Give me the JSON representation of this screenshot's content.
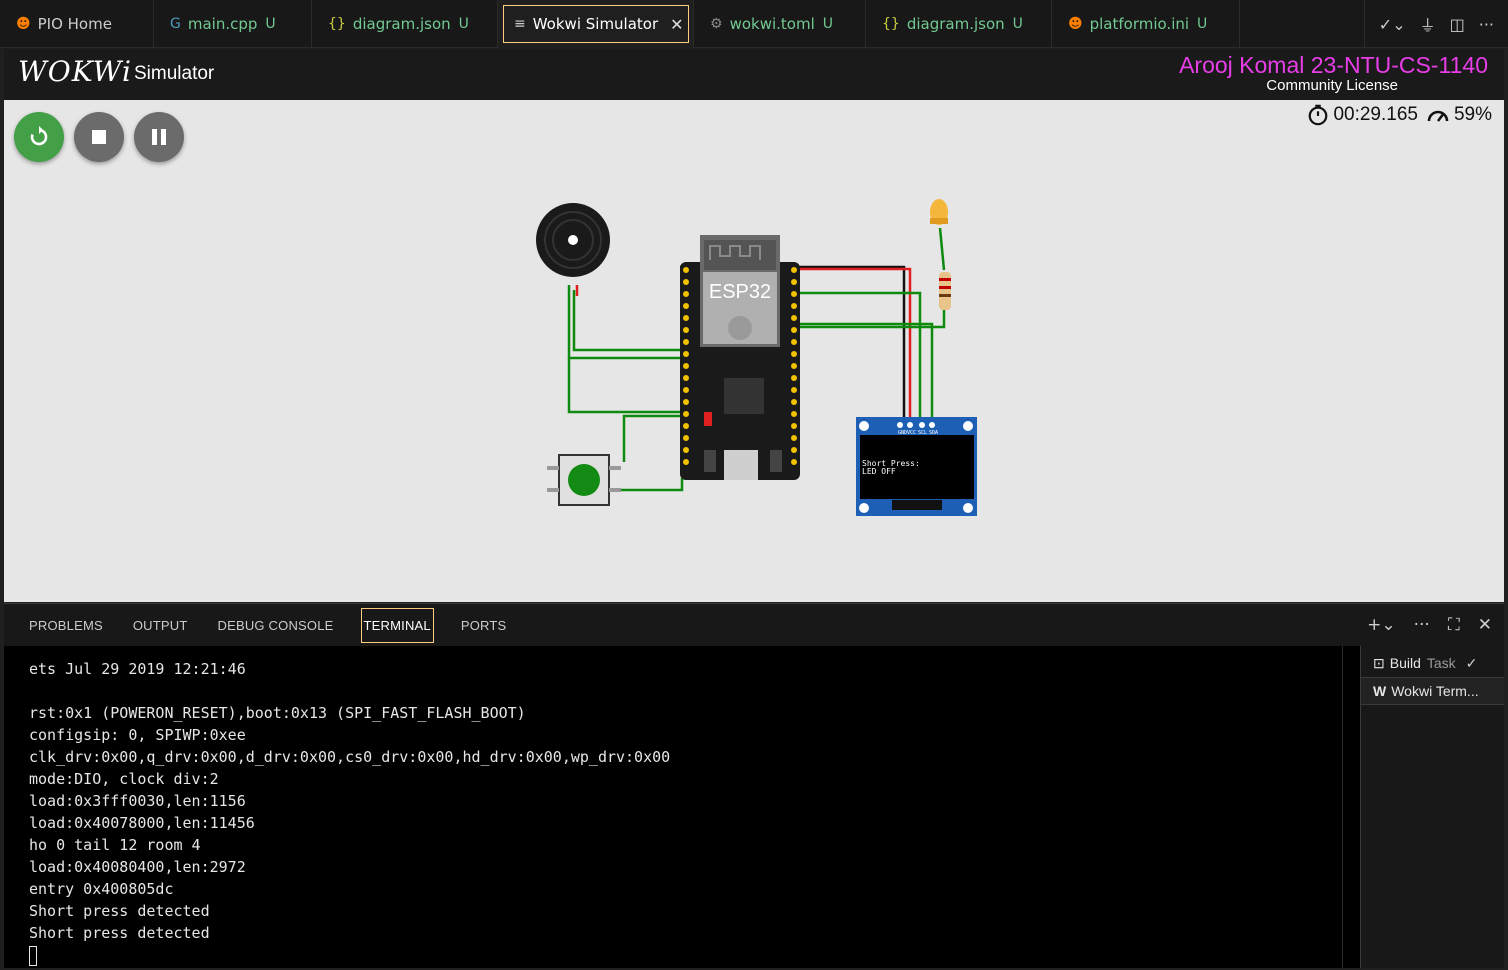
{
  "tabs": [
    {
      "label": "PIO Home",
      "icon": "platformio-icon",
      "modified": "",
      "color": "#ff7f00"
    },
    {
      "label": "main.cpp",
      "icon": "cpp-file-icon",
      "modified": "U"
    },
    {
      "label": "diagram.json",
      "icon": "json-braces-icon",
      "modified": "U"
    },
    {
      "label": "Wokwi Simulator",
      "icon": "preview-icon",
      "modified": "",
      "active": true
    },
    {
      "label": "wokwi.toml",
      "icon": "gear-icon",
      "modified": "U"
    },
    {
      "label": "diagram.json",
      "icon": "json-braces-icon",
      "modified": "U"
    },
    {
      "label": "platformio.ini",
      "icon": "platformio-icon",
      "modified": "U"
    }
  ],
  "header": {
    "logo": "WOKWi",
    "subtitle": "Simulator",
    "license_name": "Arooj Komal 23-NTU-CS-1140",
    "license_type": "Community License"
  },
  "simulator": {
    "elapsed": "00:29.165",
    "speed": "59%",
    "board_label": "ESP32",
    "oled_line1": "Short Press:",
    "oled_line2": "LED OFF",
    "oled_pins": [
      "GND",
      "VCC",
      "SCL",
      "SDA"
    ]
  },
  "panel": {
    "tabs": [
      "PROBLEMS",
      "OUTPUT",
      "DEBUG CONSOLE",
      "TERMINAL",
      "PORTS"
    ],
    "active_tab": "TERMINAL"
  },
  "terminal_lines": [
    "ets Jul 29 2019 12:21:46",
    "",
    "rst:0x1 (POWERON_RESET),boot:0x13 (SPI_FAST_FLASH_BOOT)",
    "configsip: 0, SPIWP:0xee",
    "clk_drv:0x00,q_drv:0x00,d_drv:0x00,cs0_drv:0x00,hd_drv:0x00,wp_drv:0x00",
    "mode:DIO, clock div:2",
    "load:0x3fff0030,len:1156",
    "load:0x40078000,len:11456",
    "ho 0 tail 12 room 4",
    "load:0x40080400,len:2972",
    "entry 0x400805dc",
    "Short press detected",
    "Short press detected"
  ],
  "terminal_list": [
    {
      "label": "Build",
      "suffix": "Task",
      "icon": "terminal-icon"
    },
    {
      "label": "Wokwi Term...",
      "suffix": "",
      "icon": "wokwi-icon"
    }
  ],
  "colors": {
    "accent": "#ffcc80",
    "license": "#e83ee8",
    "restart": "#43a047",
    "wire_green": "#0e8a0e",
    "wire_red": "#e02020"
  }
}
